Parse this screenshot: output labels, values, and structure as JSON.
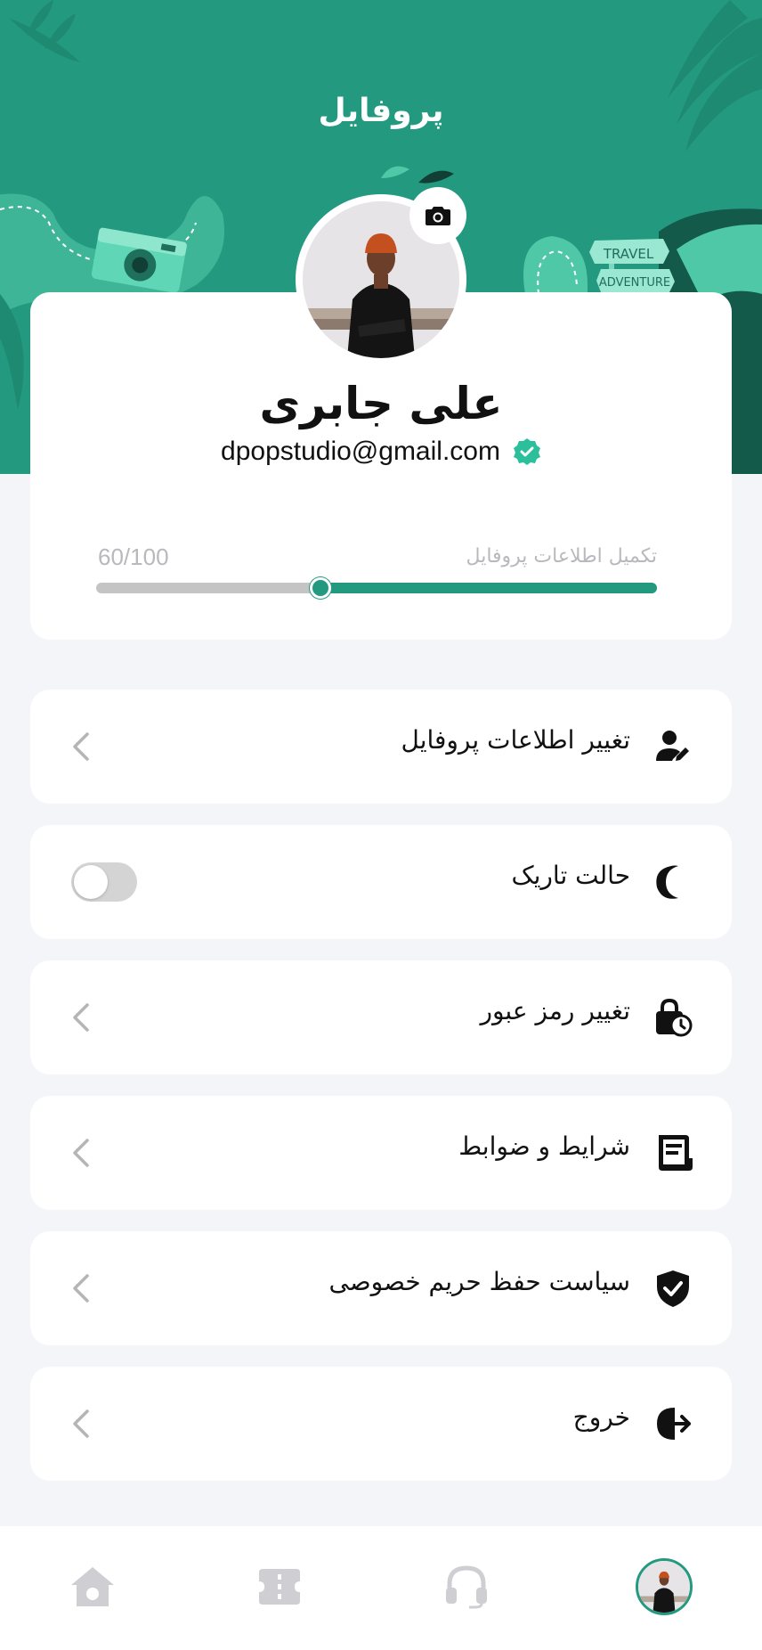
{
  "header": {
    "title": "پروفایل",
    "bg_color": "#239a80",
    "sign_top": "TRAVEL",
    "sign_bottom": "ADVENTURE"
  },
  "profile": {
    "name": "علی جابری",
    "email": "dpopstudio@gmail.com",
    "verified": true,
    "completion_label": "تکمیل اطلاعات پروفایل",
    "completion_text": "60/100",
    "completion_fraction": 0.6
  },
  "menu": [
    {
      "label": "تغییر اطلاعات پروفایل",
      "icon": "user-edit-icon",
      "action": "chevron"
    },
    {
      "label": "حالت تاریک",
      "icon": "moon-icon",
      "action": "toggle",
      "toggle_on": false
    },
    {
      "label": "تغییر رمز عبور",
      "icon": "lock-clock-icon",
      "action": "chevron"
    },
    {
      "label": "شرایط و ضوابط",
      "icon": "document-icon",
      "action": "chevron"
    },
    {
      "label": "سیاست حفظ حریم خصوصی",
      "icon": "shield-check-icon",
      "action": "chevron"
    },
    {
      "label": "خروج",
      "icon": "logout-icon",
      "action": "chevron"
    }
  ],
  "bottom_nav": [
    {
      "icon": "home-icon",
      "active": false
    },
    {
      "icon": "ticket-icon",
      "active": false
    },
    {
      "icon": "headset-icon",
      "active": false
    },
    {
      "icon": "avatar",
      "active": true
    }
  ],
  "colors": {
    "accent": "#239a80",
    "accent_light": "#4fc8a8",
    "background": "#f4f5f9",
    "muted": "#b9b9bd",
    "nav_icon": "#cfcfd3"
  }
}
